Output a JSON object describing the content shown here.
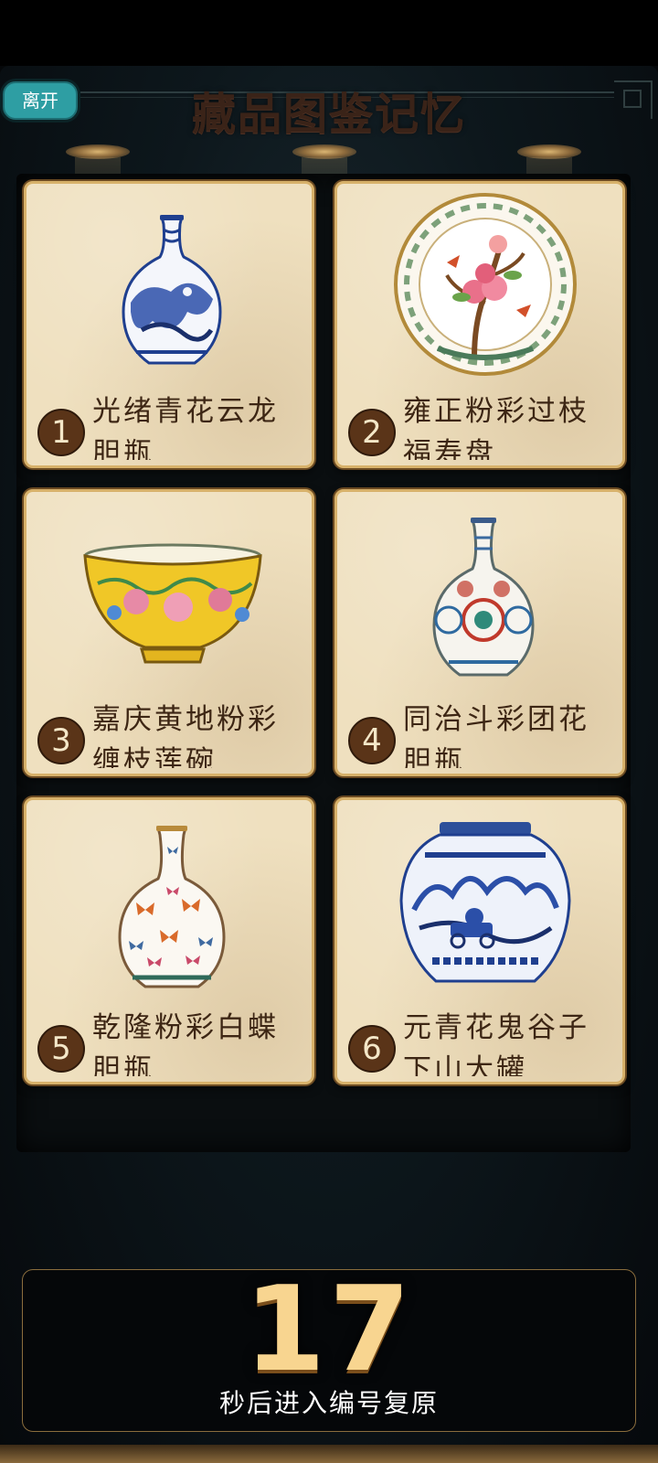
{
  "header": {
    "leave_label": "离开",
    "title": "藏品图鉴记忆"
  },
  "cards": [
    {
      "number": "1",
      "name": "光绪青花云龙胆瓶",
      "icon": "blue-white-dragon-vase-icon"
    },
    {
      "number": "2",
      "name": "雍正粉彩过枝福寿盘",
      "icon": "famille-rose-peach-plate-icon"
    },
    {
      "number": "3",
      "name": "嘉庆黄地粉彩缠枝莲碗",
      "icon": "yellow-ground-lotus-bowl-icon"
    },
    {
      "number": "4",
      "name": "同治斗彩团花胆瓶",
      "icon": "doucai-medallion-vase-icon"
    },
    {
      "number": "5",
      "name": "乾隆粉彩白蝶胆瓶",
      "icon": "butterfly-vase-icon"
    },
    {
      "number": "6",
      "name": "元青花鬼谷子下山大罐",
      "icon": "blue-white-guiguzi-jar-icon"
    }
  ],
  "timer": {
    "seconds": "17",
    "label": "秒后进入编号复原"
  },
  "colors": {
    "accent_button": "#2e9ea3",
    "card_border": "#d7b16a",
    "timer_gold": "#f8d590",
    "porcelain_blue": "#1f3f8f"
  }
}
